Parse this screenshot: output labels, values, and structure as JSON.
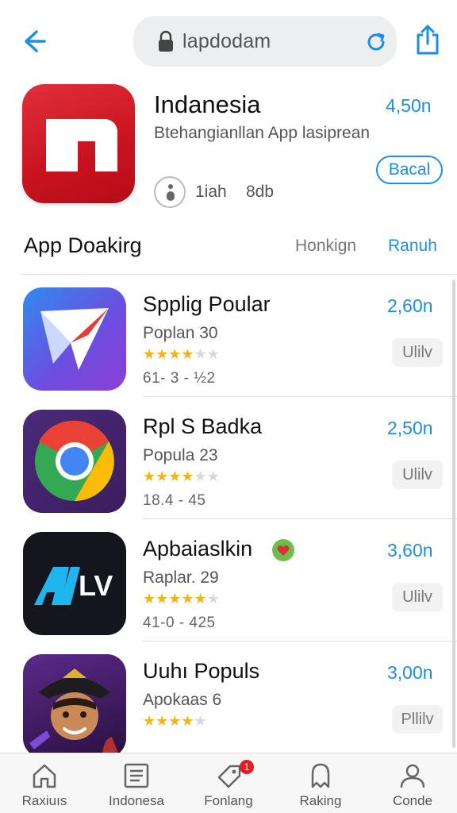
{
  "header": {
    "url": "lapdodam"
  },
  "featured": {
    "title": "Indanesia",
    "price": "4,50n",
    "subtitle": "Btehangianllan App lasiprean",
    "get_label": "Bacal",
    "meta_a": "1iah",
    "meta_b": "8db",
    "colors": {
      "icon_bg": "#d41a26",
      "accent": "#1b8fe6"
    }
  },
  "section": {
    "title": "App Doakirg",
    "link_secondary": "Honkign",
    "link_primary": "Ranuh"
  },
  "apps": [
    {
      "name": "Spplig Poular",
      "price": "2,60n",
      "sub": "Poplan 30",
      "rating": 3.5,
      "stats": "61- 3 - ½2",
      "get_label": "Ulilv",
      "icon": "paper-plane-icon"
    },
    {
      "name": "Rpl S Badka",
      "price": "2,50n",
      "sub": "Popula 23",
      "rating": 3.5,
      "stats": "18.4 - 45",
      "get_label": "Ulilv",
      "icon": "chrome-icon"
    },
    {
      "name": "Apbaiaslkin",
      "price": "3,60n",
      "sub": "Raplar. 29",
      "rating": 4.5,
      "stats": "41-0 - 425",
      "get_label": "Ulilv",
      "icon": "alv-icon",
      "badge_icon": "green-heart-badge-icon"
    },
    {
      "name": "Uuhı Populs",
      "price": "3,00n",
      "sub": "Apokaas 6",
      "rating": 3.5,
      "stats": "",
      "get_label": "Pllilv",
      "icon": "pirate-character-icon"
    }
  ],
  "nav": [
    {
      "label": "Raxiuıs",
      "icon": "home-icon"
    },
    {
      "label": "Indonesa",
      "icon": "list-icon"
    },
    {
      "label": "Fonlang",
      "icon": "tag-icon",
      "badge": "1"
    },
    {
      "label": "Raking",
      "icon": "ranking-icon"
    },
    {
      "label": "Conde",
      "icon": "profile-icon"
    }
  ]
}
